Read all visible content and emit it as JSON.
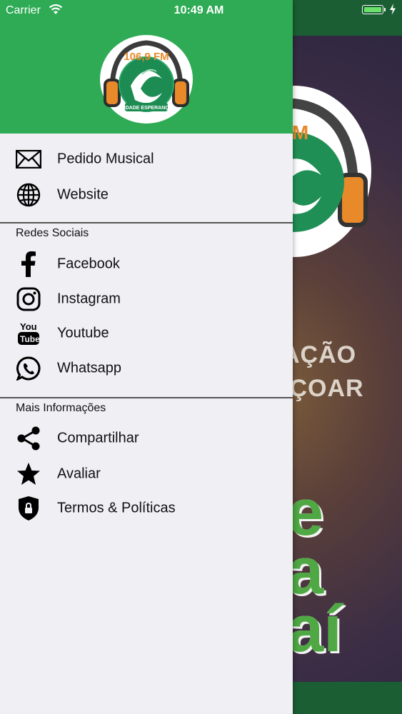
{
  "status_bar": {
    "carrier": "Carrier",
    "time": "10:49 AM"
  },
  "logo": {
    "frequency": "106,9 FM",
    "station": "CIDADE ESPERANÇA"
  },
  "background": {
    "text_line1": "AÇÃO",
    "text_line2": "IÇOAR",
    "big_line1": "e",
    "big_line2": "a",
    "big_line3": "aí"
  },
  "menu": {
    "main_items": [
      {
        "label": "Pedido Musical",
        "icon": "envelope-icon"
      },
      {
        "label": "Website",
        "icon": "globe-icon"
      }
    ],
    "social_title": "Redes Sociais",
    "social_items": [
      {
        "label": "Facebook",
        "icon": "facebook-icon"
      },
      {
        "label": "Instagram",
        "icon": "instagram-icon"
      },
      {
        "label": "Youtube",
        "icon": "youtube-icon"
      },
      {
        "label": "Whatsapp",
        "icon": "whatsapp-icon"
      }
    ],
    "info_title": "Mais Informações",
    "info_items": [
      {
        "label": "Compartilhar",
        "icon": "share-icon"
      },
      {
        "label": "Avaliar",
        "icon": "star-icon"
      },
      {
        "label": "Termos & Políticas",
        "icon": "shield-lock-icon"
      }
    ]
  },
  "colors": {
    "header_green": "#2eab54",
    "dark_green": "#1b5e34",
    "drawer_bg": "#efeff4"
  }
}
